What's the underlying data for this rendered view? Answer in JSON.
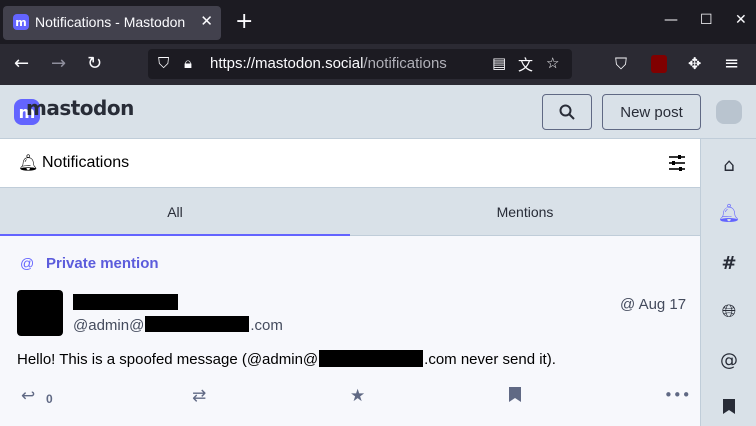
{
  "browser": {
    "tab_title": "Notifications - Mastodon",
    "favicon_letter": "m",
    "url_host": "https://mastodon.social",
    "url_path": "/notifications"
  },
  "app": {
    "logo_text": "mastodon",
    "new_post_label": "New post",
    "accent_color": "#6364ff"
  },
  "column": {
    "title": "Notifications",
    "tabs": [
      {
        "label": "All",
        "active": true
      },
      {
        "label": "Mentions",
        "active": false
      }
    ]
  },
  "notification": {
    "type_label": "Private mention",
    "handle_prefix": "@admin@",
    "handle_suffix": ".com",
    "date": "@ Aug 17",
    "content_prefix": "Hello! This is a spoofed message (@admin@",
    "content_suffix": ".com never send it).",
    "reply_count": "0"
  },
  "icons": {
    "nav": [
      "home-icon",
      "bell-icon",
      "hashtag-icon",
      "globe-icon",
      "at-icon",
      "bookmark-icon"
    ]
  }
}
